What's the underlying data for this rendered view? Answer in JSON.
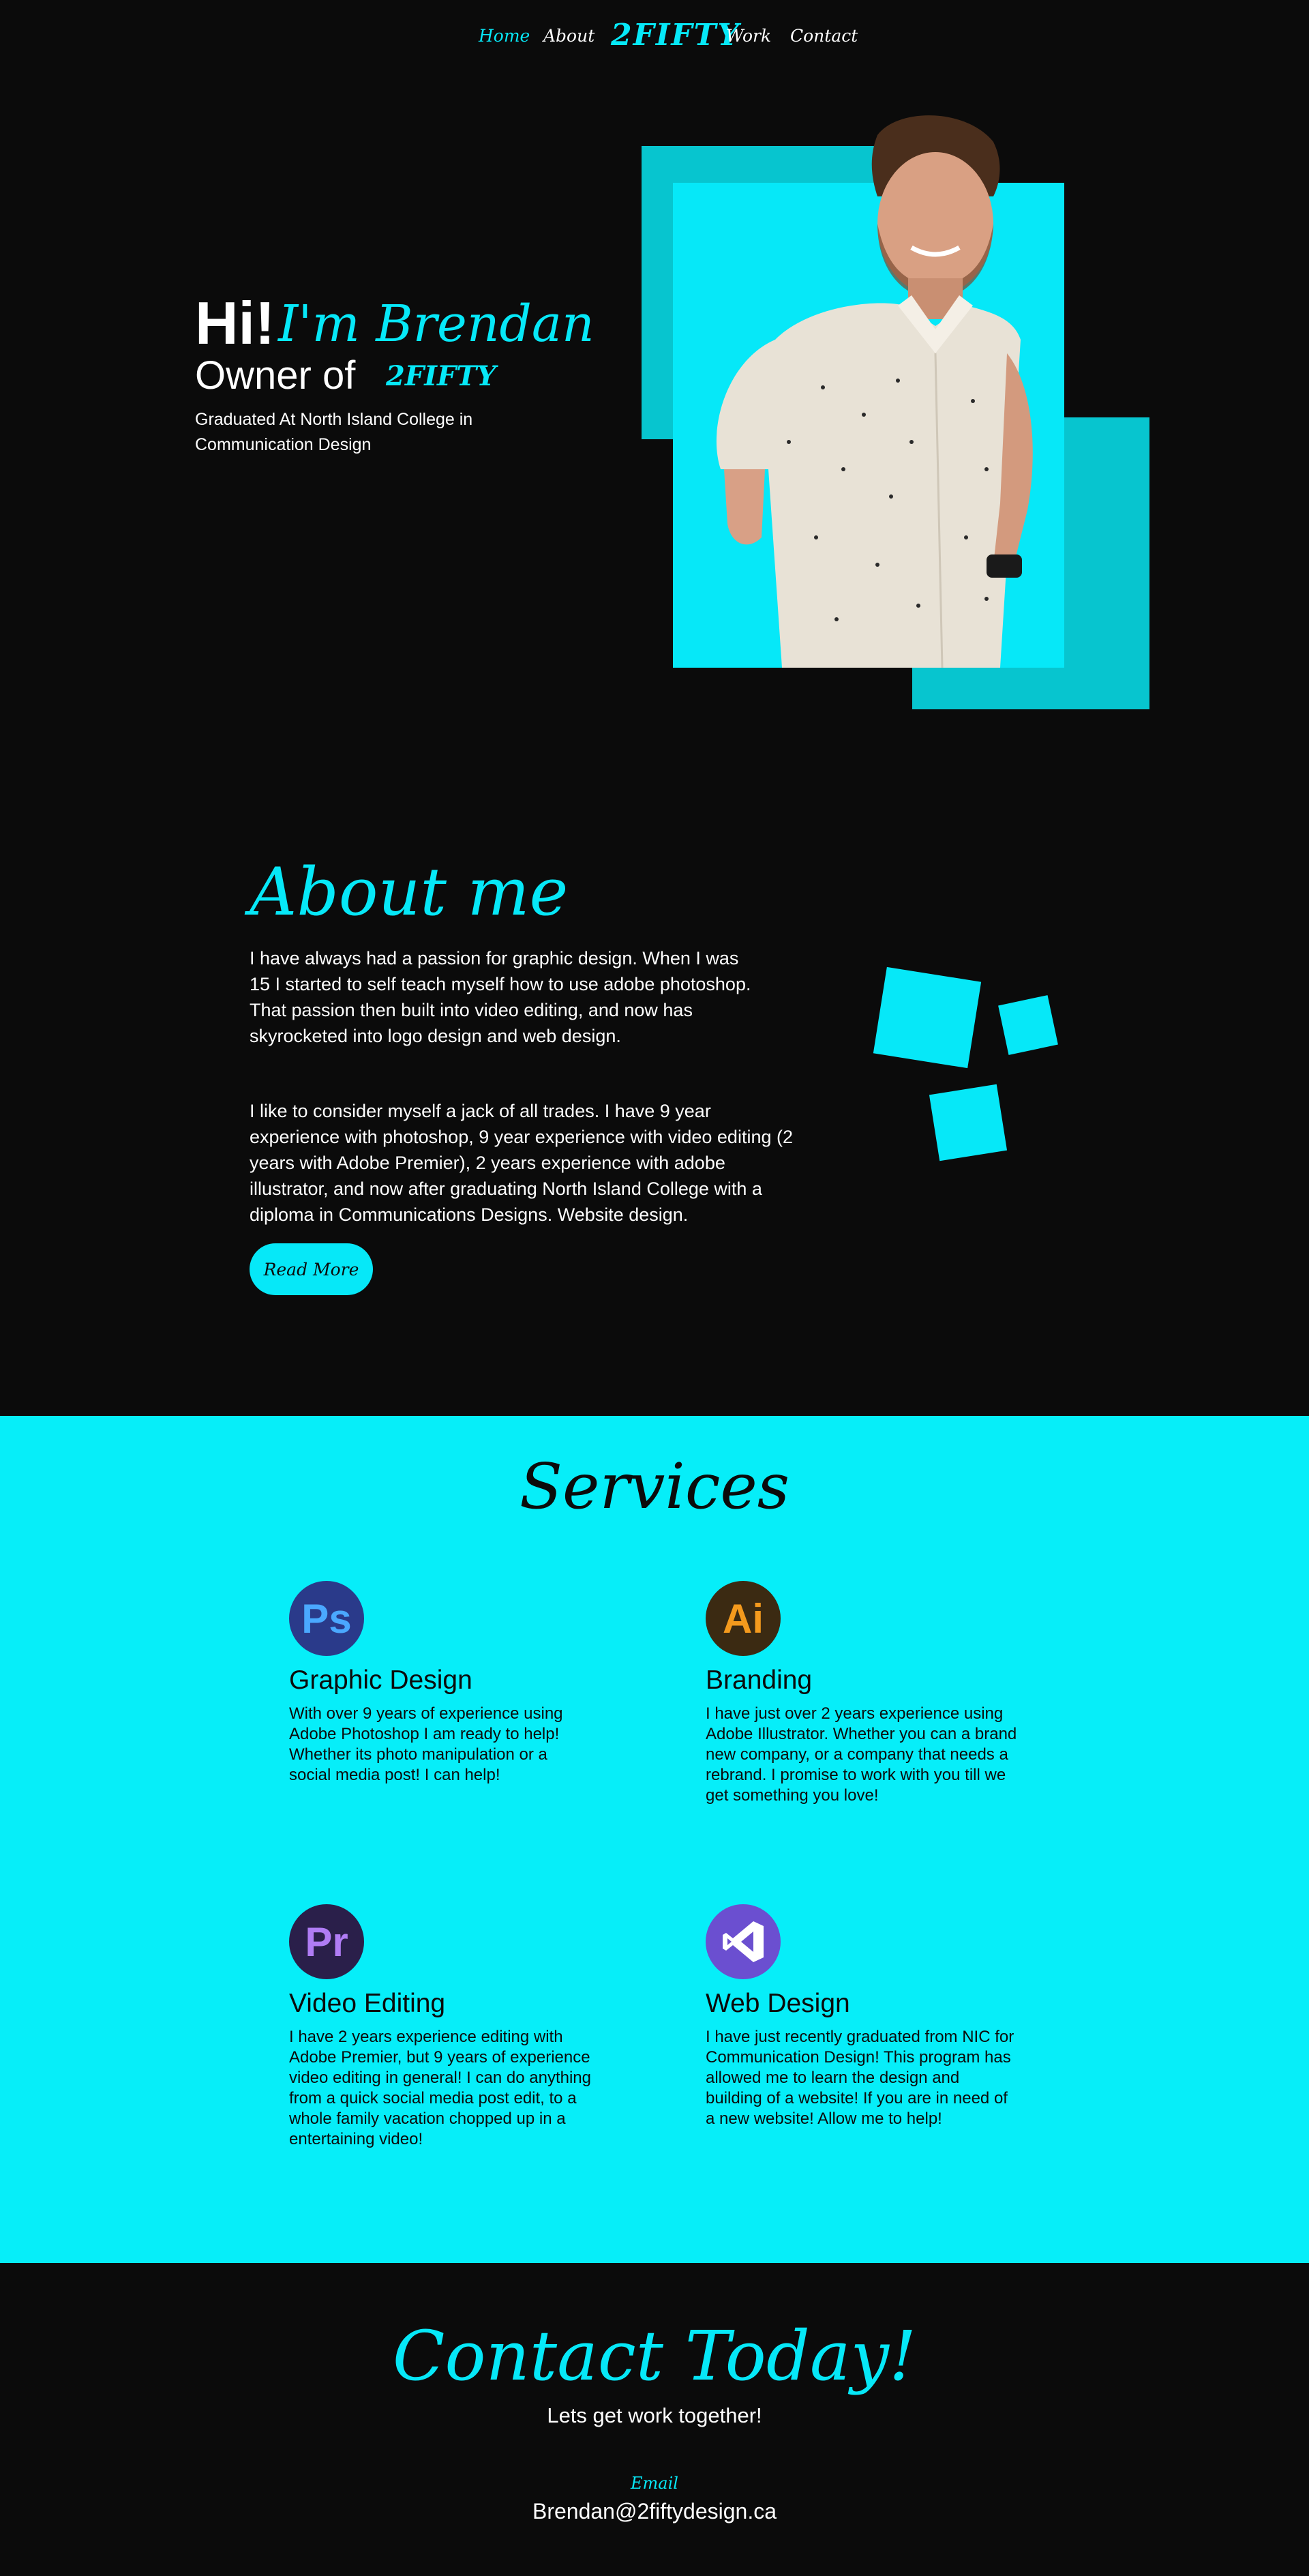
{
  "nav": {
    "items": [
      "Home",
      "About",
      "Work",
      "Contact"
    ],
    "logo": "2FIFTY"
  },
  "hero": {
    "greeting": "Hi!",
    "name": "I'm Brendan",
    "owner_label": "Owner of",
    "owner_logo": "2FIFTY",
    "subtitle": "Graduated At North Island College in Communication Design"
  },
  "about": {
    "title": "About me",
    "paragraph1": "I have always had a passion for graphic design. When I was 15 I started to self teach myself how to use adobe photoshop. That passion then built into video editing, and now has skyrocketed into logo design and web design.",
    "paragraph2": "I like to consider myself a jack of all trades. I have 9 year experience with photoshop, 9 year experience with video editing (2 years with Adobe Premier), 2 years experience with adobe illustrator, and now after graduating North Island College with a diploma in Communications Designs. Website design.",
    "button": "Read More"
  },
  "services": {
    "title": "Services",
    "items": [
      {
        "icon": "Ps",
        "icon_name": "photoshop-icon",
        "color": "#2a3a8a",
        "text_color": "#3aa0ff",
        "title": "Graphic Design",
        "desc": "With over 9 years of experience using Adobe Photoshop I am ready to help! Whether its photo manipulation or a social media post! I can help!"
      },
      {
        "icon": "Ai",
        "icon_name": "illustrator-icon",
        "color": "#3b2a12",
        "text_color": "#f49a1d",
        "title": "Branding",
        "desc": "I have just over 2 years experience using Adobe Illustrator. Whether you can a brand new company, or a company that needs a rebrand. I promise to work with you till we get something you love!"
      },
      {
        "icon": "Pr",
        "icon_name": "premiere-icon",
        "color": "#2a1f4a",
        "text_color": "#b07cf5",
        "title": "Video Editing",
        "desc": "I have 2 years experience editing with Adobe Premier, but 9 years of experience video editing in general! I can do anything from a quick social media post edit, to a whole family vacation chopped up in a entertaining video!"
      },
      {
        "icon": "VS",
        "icon_name": "visual-studio-icon",
        "color": "#6b4fd0",
        "text_color": "#ffffff",
        "title": "Web Design",
        "desc": "I have just recently graduated from NIC for Communication Design! This program has allowed me to learn the design and building of a website! If you are in need of a new website! Allow me to help!"
      }
    ]
  },
  "contact": {
    "title": "Contact Today!",
    "subtitle": "Lets get work together!",
    "email_label": "Email",
    "email": "Brendan@2fiftydesign.ca"
  },
  "colors": {
    "accent": "#06e8f8",
    "accent_dark": "#07c5cf",
    "background": "#0b0b0b"
  }
}
